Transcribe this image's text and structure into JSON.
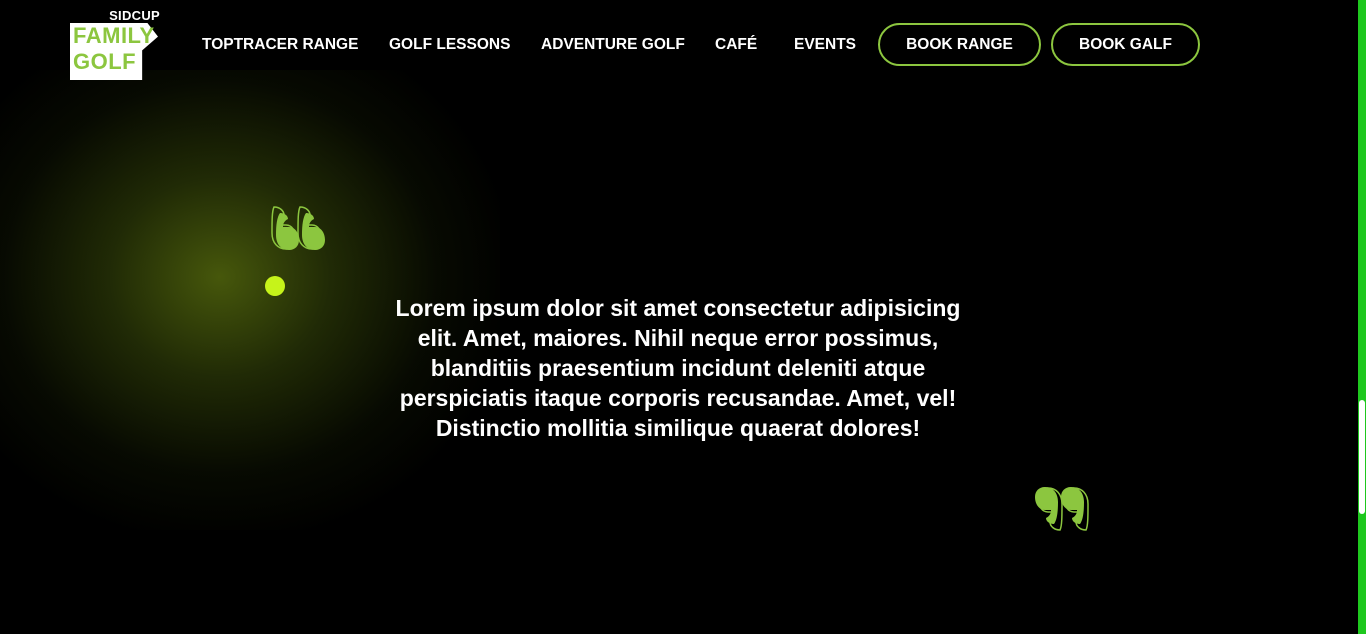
{
  "logo": {
    "top_text": "SIDCUP",
    "line1": "FAMILY",
    "line2": "GOLF"
  },
  "nav": {
    "links": [
      "TOPTRACER RANGE",
      "GOLF LESSONS",
      "ADVENTURE GOLF",
      "CAFÉ",
      "EVENTS"
    ],
    "buttons": [
      "BOOK RANGE",
      "BOOK GALF"
    ]
  },
  "testimonial": {
    "text": "Lorem ipsum dolor sit amet consectetur adipisicing elit. Amet, maiores. Nihil neque error possimus, blanditiis praesentium incidunt deleniti atque perspiciatis itaque corporis recusandae. Amet, vel! Distinctio mollitia similique quaerat dolores!",
    "open_quote_icon": "quote-open-icon",
    "close_quote_icon": "quote-close-icon"
  },
  "colors": {
    "background": "#000000",
    "accent_green": "#8cc63f",
    "dot_lime": "#c6f31a",
    "scrollbar_track": "#1ec81e",
    "text": "#ffffff"
  }
}
